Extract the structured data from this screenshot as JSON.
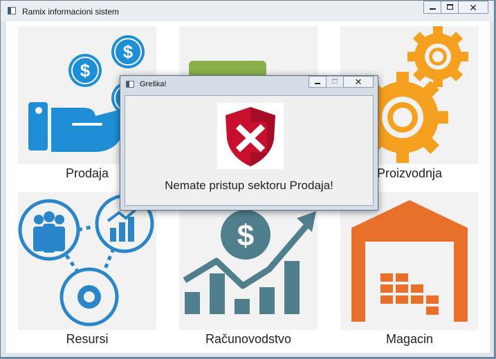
{
  "window": {
    "title": "Ramix informacioni sistem",
    "controls": {
      "minimize": "",
      "maximize": "",
      "close": "✕"
    }
  },
  "tiles": [
    {
      "label": "Prodaja",
      "icon": "money-hand-icon",
      "color": "#1e8fd6"
    },
    {
      "label": "",
      "icon": "document-icon",
      "color": "#8ab04a"
    },
    {
      "label": "Proizvodnja",
      "icon": "gears-icon",
      "color": "#f5a01e"
    },
    {
      "label": "Resursi",
      "icon": "people-network-icon",
      "color": "#2a86c8"
    },
    {
      "label": "Računovodstvo",
      "icon": "finance-chart-icon",
      "color": "#4f7f8c"
    },
    {
      "label": "Magacin",
      "icon": "warehouse-icon",
      "color": "#e8702a"
    }
  ],
  "dialog": {
    "title": "Greška!",
    "icon": "error-shield-icon",
    "message": "Nemate pristup sektoru Prodaja!",
    "close": "✕",
    "colors": {
      "shield": "#c8102e",
      "cross": "#ffffff"
    }
  }
}
